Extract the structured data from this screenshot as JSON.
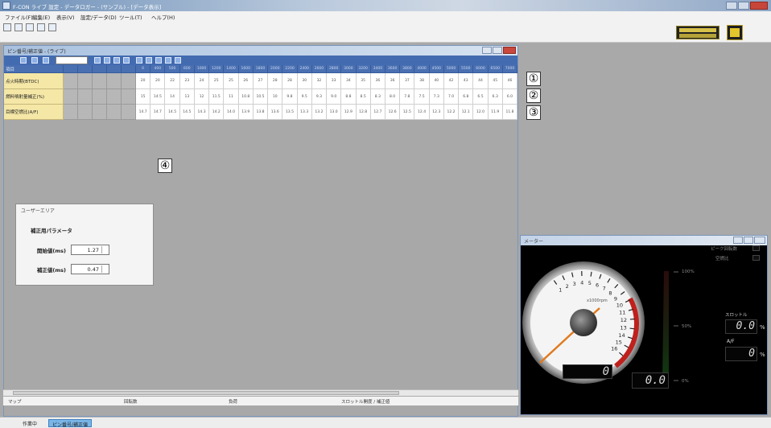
{
  "window": {
    "title": "F-CON ライブ 設定 - データロガー - (サンプル) - [データ表示]"
  },
  "menu": [
    "ファイル(F)",
    "編集(E)",
    "表示(V)",
    "設定/データ(D)",
    "ツール(T)",
    "ヘルプ(H)"
  ],
  "child_window": {
    "title": "ピン番号/補正値 - (ライブ)"
  },
  "table": {
    "header_label": "項目",
    "columns": [
      "0",
      "400",
      "500",
      "600",
      "1000",
      "1200",
      "1400",
      "1600",
      "1800",
      "2000",
      "2200",
      "2400",
      "2600",
      "2800",
      "3000",
      "3200",
      "3400",
      "3600",
      "3800",
      "4000",
      "4500",
      "5000",
      "5500",
      "6000",
      "6500",
      "7000"
    ],
    "rows": [
      {
        "label": "点火時期(BTDC)",
        "values": [
          "20",
          "20",
          "22",
          "23",
          "24",
          "25",
          "25",
          "26",
          "27",
          "28",
          "28",
          "30",
          "32",
          "33",
          "34",
          "35",
          "36",
          "36",
          "37",
          "38",
          "40",
          "42",
          "43",
          "44",
          "45",
          "46"
        ]
      },
      {
        "label": "燃料噴射量補正(%)",
        "values": [
          "15",
          "14.5",
          "14",
          "13",
          "12",
          "11.5",
          "11",
          "10.8",
          "10.5",
          "10",
          "9.8",
          "9.5",
          "9.3",
          "9.0",
          "8.8",
          "8.5",
          "8.3",
          "8.0",
          "7.8",
          "7.5",
          "7.3",
          "7.0",
          "6.8",
          "6.5",
          "6.3",
          "6.0"
        ]
      },
      {
        "label": "目標空燃比(A/F)",
        "values": [
          "14.7",
          "14.7",
          "14.5",
          "14.5",
          "14.3",
          "14.2",
          "14.0",
          "13.9",
          "13.8",
          "13.6",
          "13.5",
          "13.3",
          "13.2",
          "13.0",
          "12.9",
          "12.8",
          "12.7",
          "12.6",
          "12.5",
          "12.4",
          "12.3",
          "12.2",
          "12.1",
          "12.0",
          "11.9",
          "11.8"
        ]
      }
    ]
  },
  "badges": [
    "①",
    "②",
    "③",
    "④"
  ],
  "user_area": {
    "label": "ユーザーエリア",
    "heading": "補正用パラメータ",
    "fields": [
      {
        "label": "開始値(ms)",
        "value": "1.27"
      },
      {
        "label": "補正値(ms)",
        "value": "0.47"
      }
    ]
  },
  "status": [
    "マップ",
    "回転数",
    "負荷",
    "スロットル開度 / 補正値"
  ],
  "taskbar": [
    "作業中",
    "ピン番号/補正値"
  ],
  "gauge": {
    "title": "メーター",
    "unit": "x1000rpm",
    "ticks": [
      "1",
      "2",
      "3",
      "4",
      "5",
      "6",
      "7",
      "8",
      "9",
      "10",
      "11",
      "12",
      "13",
      "14",
      "15",
      "16"
    ],
    "bar_labels": [
      "100%",
      "50%",
      "0%"
    ],
    "rpm_value": "0",
    "speed_value": "0.0",
    "throttle_label": "スロットル",
    "throttle_value": "0.0",
    "throttle_unit": "%",
    "afr_label": "A/F",
    "afr_value": "0",
    "afr_unit": "%",
    "legend": [
      "ピーク回転数",
      "空燃比"
    ],
    "colors": {
      "redzone": "#c0201c",
      "needle": "#e07a1e"
    }
  }
}
